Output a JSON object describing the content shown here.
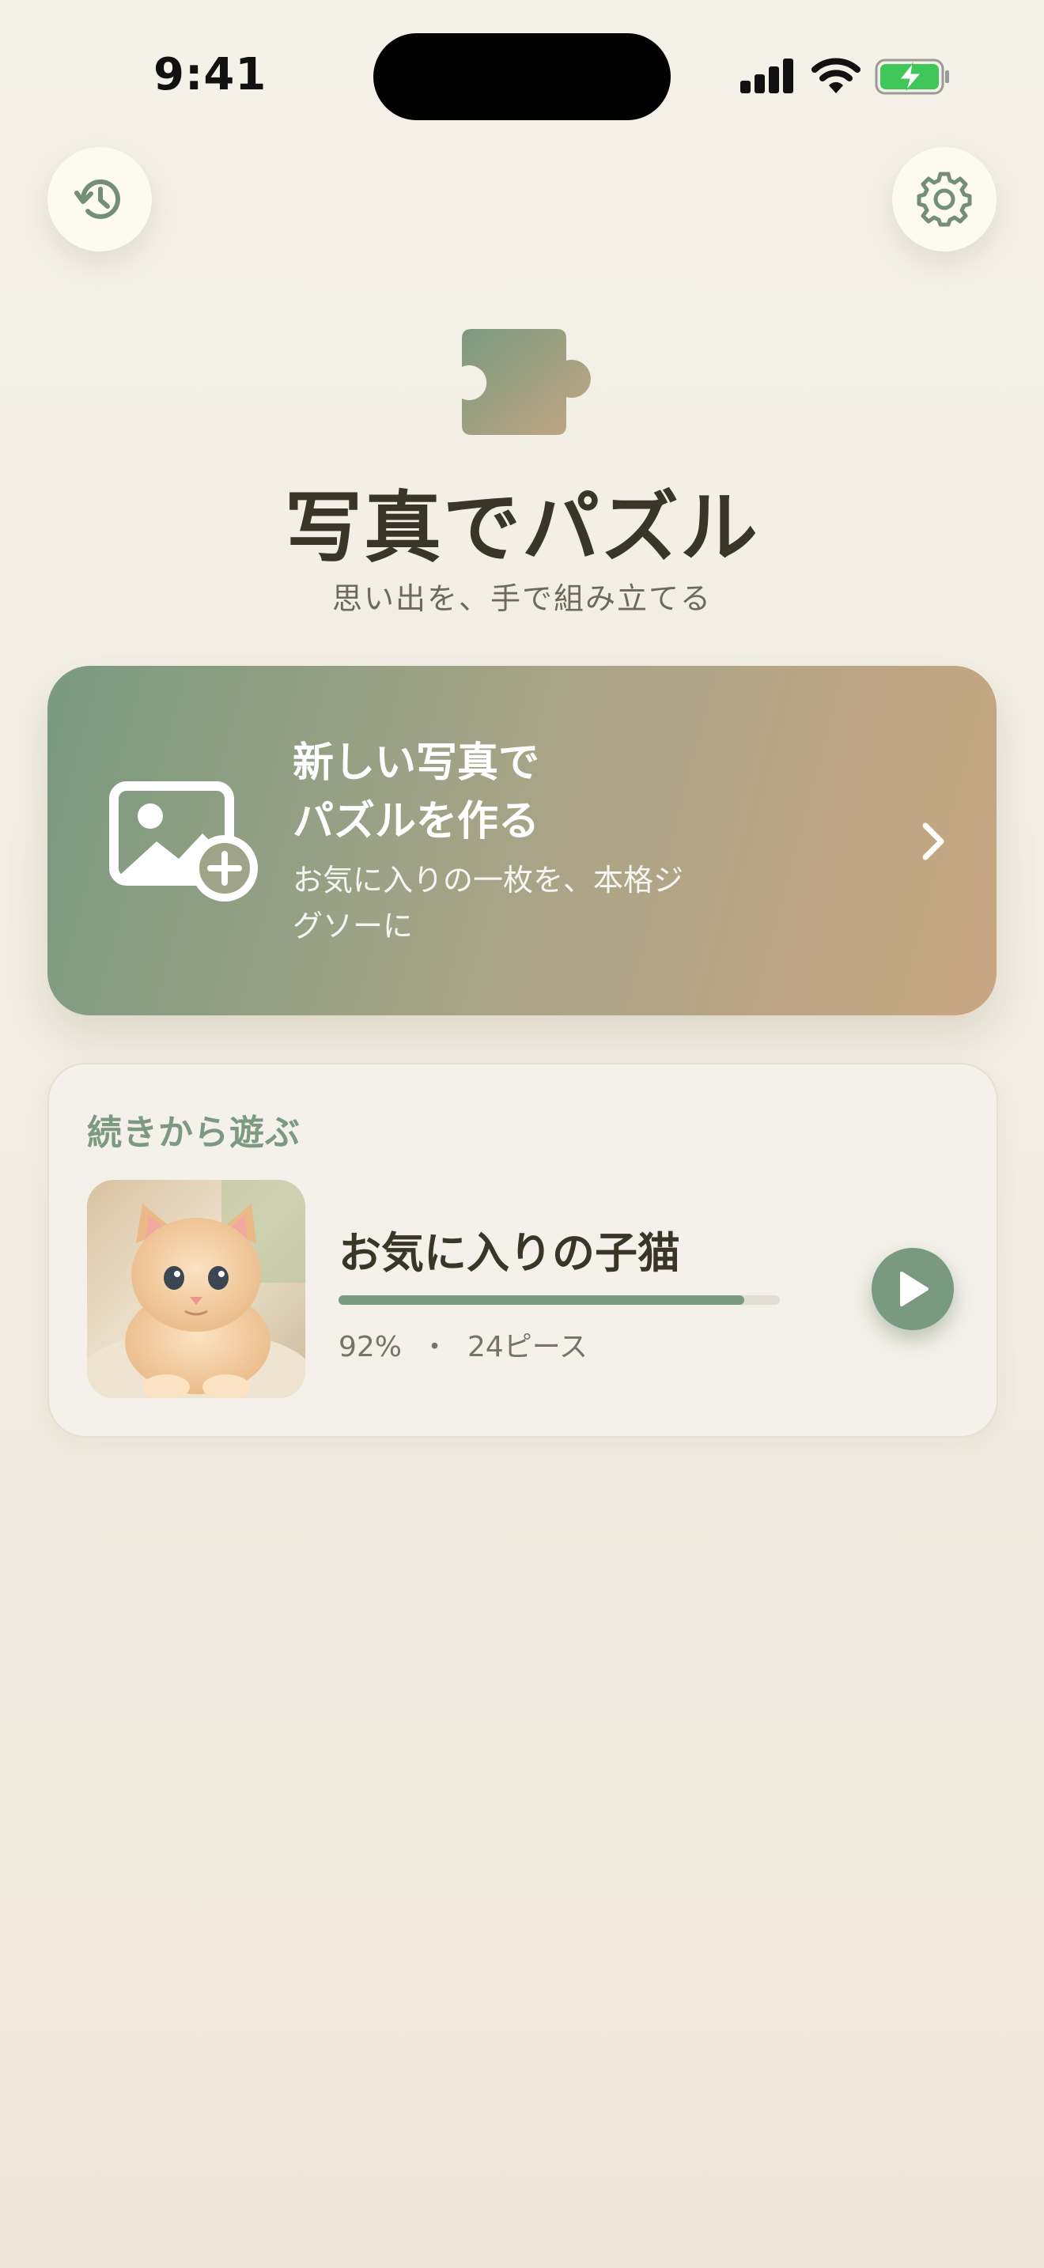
{
  "status_bar": {
    "time": "9:41"
  },
  "header": {
    "history_icon": "history-icon",
    "settings_icon": "gear-icon"
  },
  "hero": {
    "logo_icon": "puzzle-piece-icon",
    "title": "写真でパズル",
    "subtitle": "思い出を、手で組み立てる"
  },
  "new_puzzle": {
    "title_line1": "新しい写真で",
    "title_line2": "パズルを作る",
    "description": "お気に入りの一枚を、本格ジグソーに",
    "icon": "photo-add-icon",
    "chevron_icon": "chevron-right-icon"
  },
  "continue": {
    "section_label": "続きから遊ぶ",
    "puzzle_name": "お気に入りの子猫",
    "progress": 0.92,
    "progress_text": "92%",
    "separator": "・",
    "pieces_text": "24ピース",
    "play_icon": "play-icon"
  },
  "colors": {
    "accent_green": "#7a9a80",
    "accent_tan": "#c9a683",
    "background": "#f4f1e8"
  }
}
